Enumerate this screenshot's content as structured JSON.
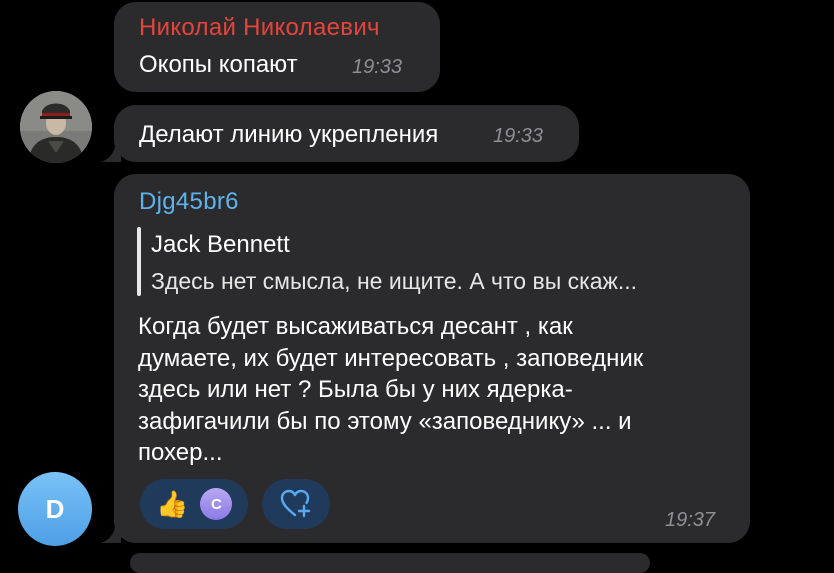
{
  "messages": [
    {
      "sender": "Николай Николаевич",
      "text": "Окопы копают",
      "time": "19:33"
    },
    {
      "text": "Делают линию укрепления",
      "time": "19:33"
    },
    {
      "sender": "Djg45br6",
      "reply": {
        "author": "Jack Bennett",
        "text": "Здесь нет смысла, не ищите. А что вы скаж..."
      },
      "lines": [
        "Когда будет высаживаться десант , как",
        "думаете, их будет интересовать , заповедник",
        "здесь или нет ? Была бы у них ядерка-",
        "зафигачили бы по этому «заповеднику» ... и",
        "похер..."
      ],
      "time": "19:37",
      "reactions": {
        "emoji": "👍",
        "reactor_initial": "C"
      }
    }
  ],
  "avatars": {
    "second_sender_initial": "D"
  },
  "colors": {
    "background": "#000000",
    "bubble": "#2b2b2d",
    "sender_red": "#e5443b",
    "sender_blue": "#5fb3ec",
    "reaction_pill": "#1f3a5a",
    "timestamp": "#8e8e93"
  }
}
